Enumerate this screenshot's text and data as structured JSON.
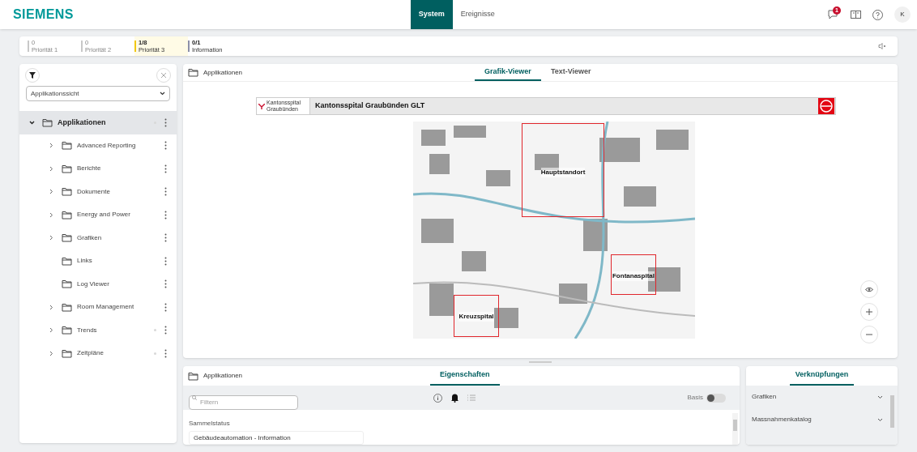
{
  "header": {
    "brand": "SIEMENS",
    "tabs": [
      {
        "label": "System",
        "selected": true
      },
      {
        "label": "Ereignisse",
        "selected": false
      }
    ],
    "notification_count": "1",
    "avatar": "K"
  },
  "summary": [
    {
      "count": "0",
      "label": "Priorität 1",
      "color": "#c8c8c8",
      "selected": false
    },
    {
      "count": "0",
      "label": "Priorität 2",
      "color": "#c8c8c8",
      "selected": false
    },
    {
      "count": "1/8",
      "label": "Priorität 3",
      "color": "#f2c811",
      "selected": true
    },
    {
      "count": "0/1",
      "label": "Information",
      "color": "#8c8fa8",
      "selected": false
    }
  ],
  "sidebar": {
    "view_select": "Applikationssicht",
    "tree": [
      {
        "label": "Applikationen",
        "expanded": true,
        "selected": true,
        "flagged": true,
        "children": [
          {
            "label": "Advanced Reporting",
            "expanded": false,
            "selected": false,
            "flagged": false
          },
          {
            "label": "Berichte",
            "expanded": false,
            "selected": false,
            "flagged": false
          },
          {
            "label": "Dokumente",
            "expanded": false,
            "selected": false,
            "flagged": false
          },
          {
            "label": "Energy and Power",
            "expanded": false,
            "selected": false,
            "flagged": false
          },
          {
            "label": "Grafiken",
            "expanded": false,
            "selected": false,
            "flagged": false
          },
          {
            "label": "Links",
            "selected": false,
            "flagged": false
          },
          {
            "label": "Log Viewer",
            "selected": false,
            "flagged": false
          },
          {
            "label": "Room Management",
            "expanded": false,
            "selected": false,
            "flagged": false
          },
          {
            "label": "Trends",
            "expanded": false,
            "selected": false,
            "flagged": true
          },
          {
            "label": "Zeitpläne",
            "expanded": false,
            "selected": false,
            "flagged": true
          }
        ]
      }
    ]
  },
  "viewer": {
    "breadcrumb": "Applikationen",
    "tabs": [
      {
        "label": "Grafik-Viewer",
        "selected": true
      },
      {
        "label": "Text-Viewer",
        "selected": false
      }
    ],
    "graphic": {
      "logo_text": [
        "Kantonsspital",
        "Graubünden"
      ],
      "title": "Kantonsspital Graubünden GLT",
      "sites": [
        "Hauptstandort",
        "Fontanaspital",
        "Kreuzspital"
      ]
    }
  },
  "properties": {
    "breadcrumb": "Applikationen",
    "tabs": [
      {
        "label": "Eigenschaften",
        "selected": true
      }
    ],
    "filter_placeholder": "Filtern",
    "basis_label": "Basis",
    "basis_on": false,
    "field_label": "Sammelstatus",
    "field_value": "Gebäudeautomation - Information"
  },
  "links": {
    "tabs": [
      {
        "label": "Verknüpfungen",
        "selected": true
      }
    ],
    "items": [
      "Grafiken",
      "Massnahmenkatalog"
    ]
  }
}
